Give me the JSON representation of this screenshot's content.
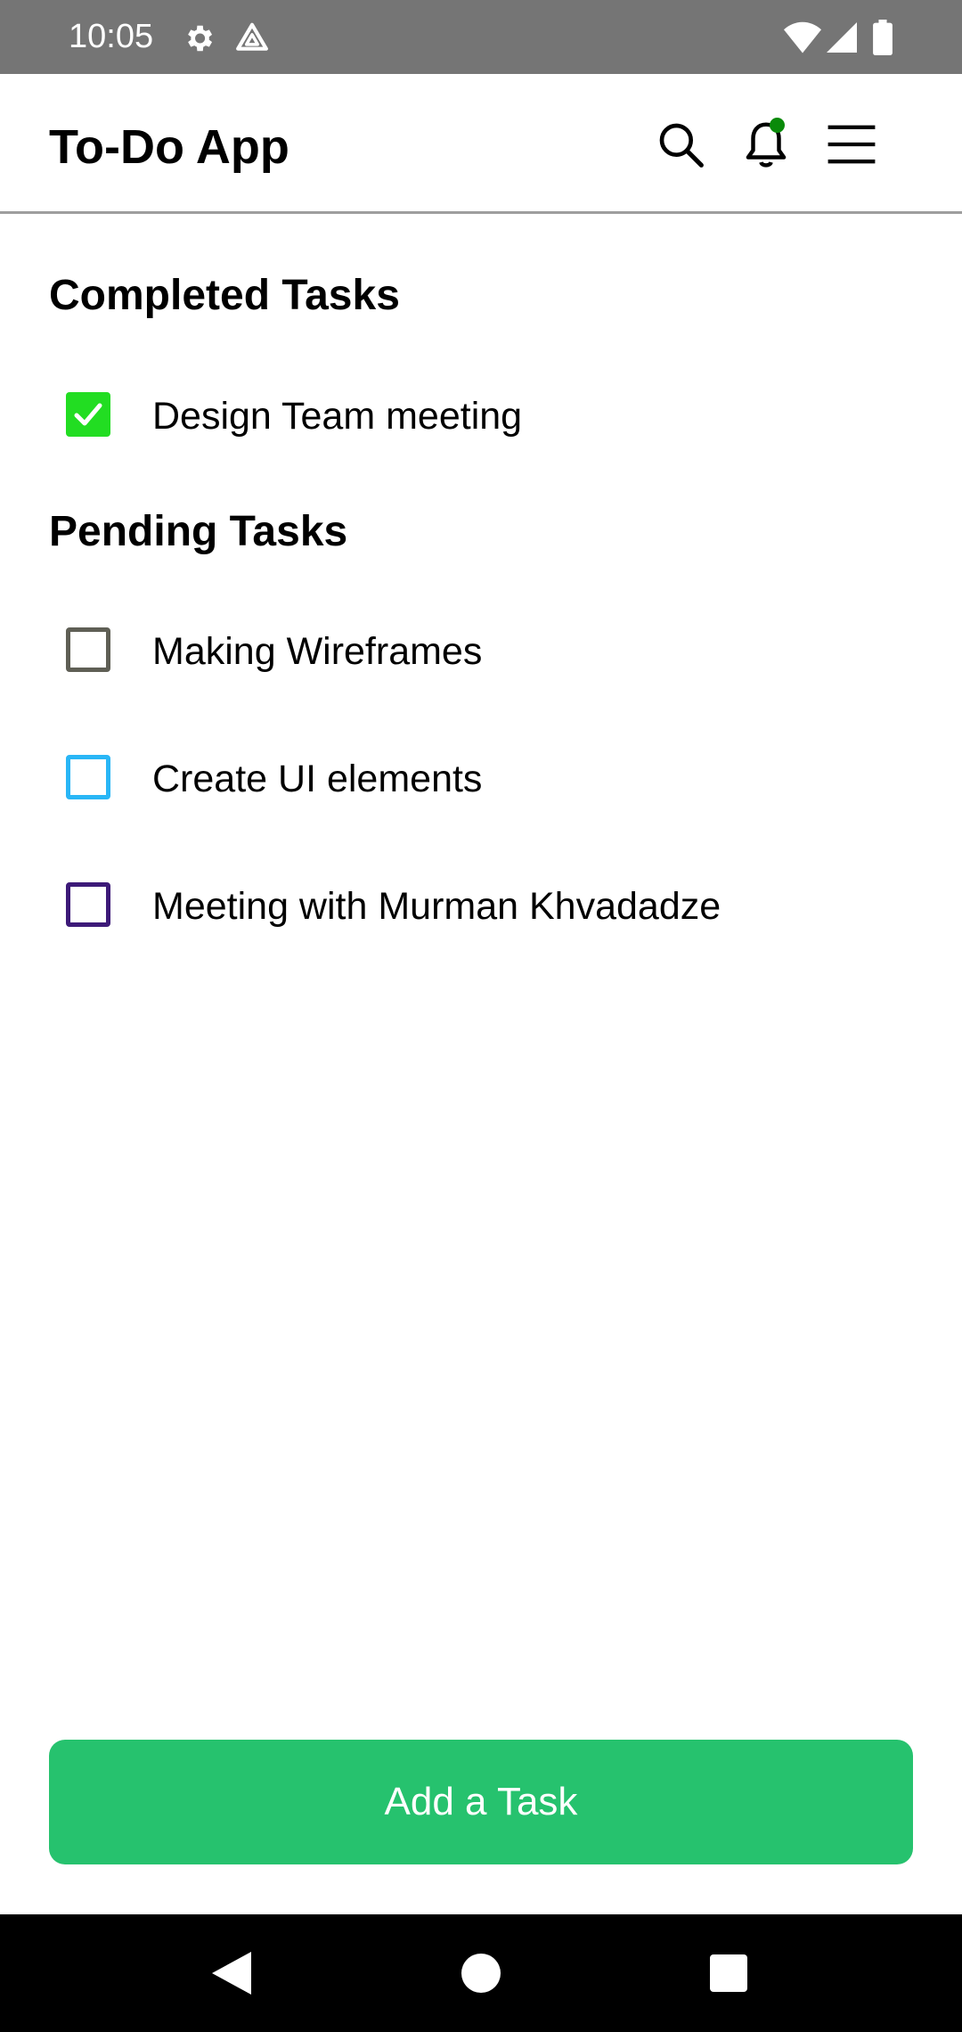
{
  "status_bar": {
    "time": "10:05",
    "icons": [
      "gear-icon",
      "drive-icon",
      "wifi-icon",
      "signal-icon",
      "battery-icon"
    ]
  },
  "app_bar": {
    "title": "To-Do App",
    "actions": [
      "search-icon",
      "bell-icon",
      "menu-icon"
    ],
    "notification_dot_color": "#0a8a0a"
  },
  "sections": {
    "completed": {
      "title": "Completed Tasks",
      "tasks": [
        {
          "label": "Design Team meeting",
          "checked": true,
          "color": "#22dd22"
        }
      ]
    },
    "pending": {
      "title": "Pending Tasks",
      "tasks": [
        {
          "label": "Making Wireframes",
          "checked": false,
          "color": "#5f5f55"
        },
        {
          "label": "Create UI elements",
          "checked": false,
          "color": "#29b6f6"
        },
        {
          "label": "Meeting with Murman Khvadadze",
          "checked": false,
          "color": "#3d1a78"
        }
      ]
    }
  },
  "add_button": {
    "label": "Add a Task",
    "color": "#26c26e"
  },
  "nav_bar": {
    "buttons": [
      "back-icon",
      "home-icon",
      "recents-icon"
    ]
  }
}
